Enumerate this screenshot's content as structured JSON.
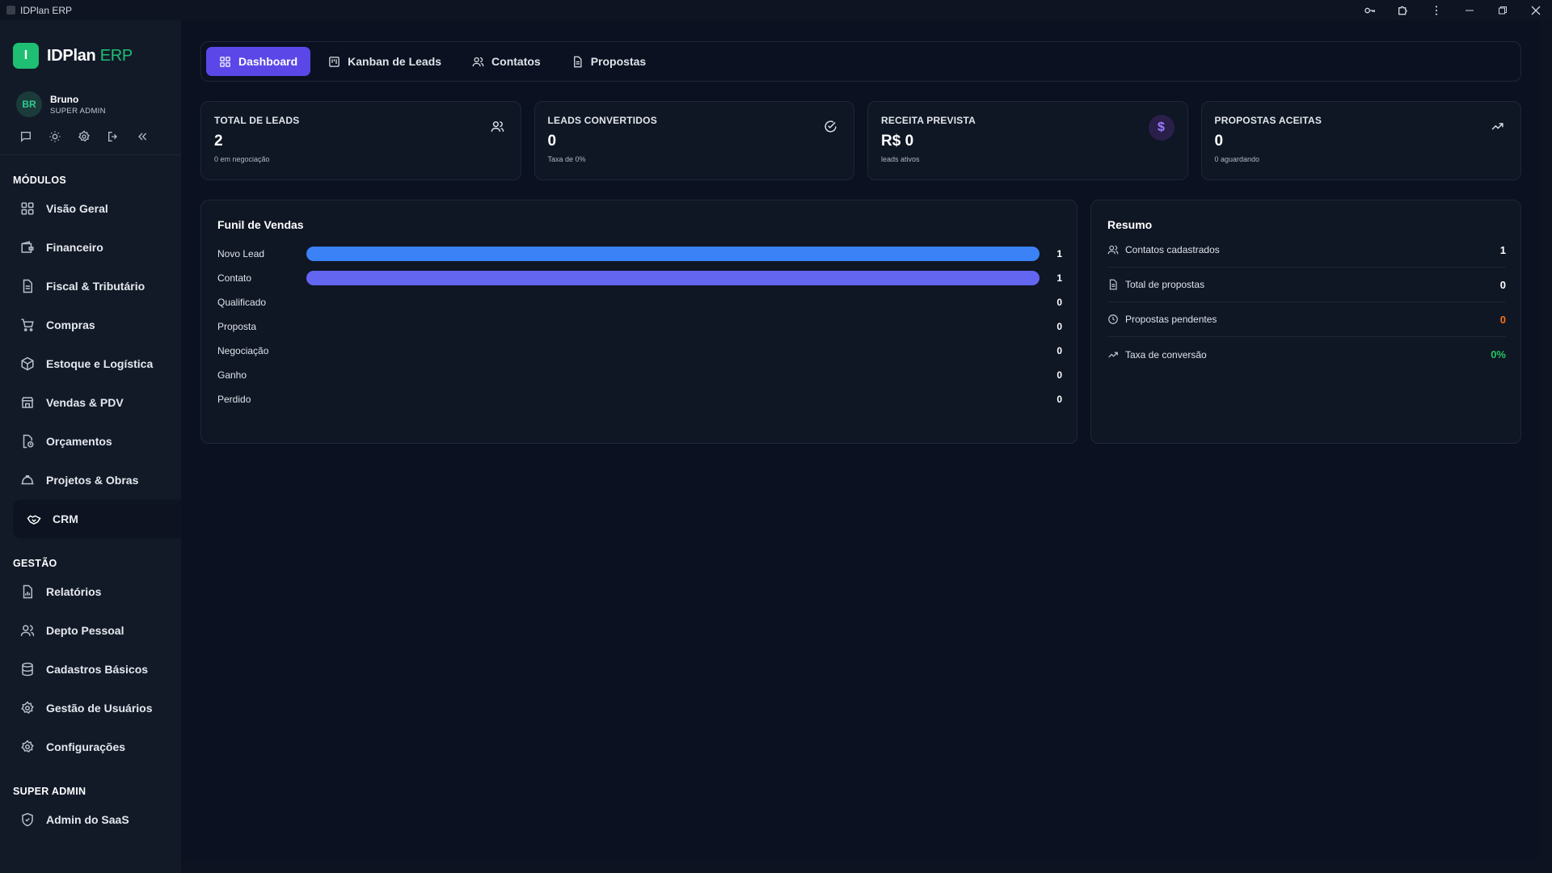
{
  "window": {
    "title": "IDPlan ERP"
  },
  "brand": {
    "logo_letter": "I",
    "name": "IDPlan",
    "suffix": "ERP",
    "accent": "#1fbf73"
  },
  "user": {
    "initials": "BR",
    "name": "Bruno",
    "role": "SUPER ADMIN"
  },
  "user_actions": [
    "chat-icon",
    "sun-icon",
    "gear-icon",
    "logout-icon",
    "collapse-icon"
  ],
  "sidebar": {
    "sections": [
      {
        "title": "MÓDULOS",
        "items": [
          {
            "label": "Visão Geral",
            "icon": "grid-icon"
          },
          {
            "label": "Financeiro",
            "icon": "wallet-icon"
          },
          {
            "label": "Fiscal & Tributário",
            "icon": "document-icon"
          },
          {
            "label": "Compras",
            "icon": "cart-icon"
          },
          {
            "label": "Estoque e Logística",
            "icon": "box-icon"
          },
          {
            "label": "Vendas & PDV",
            "icon": "store-icon"
          },
          {
            "label": "Orçamentos",
            "icon": "file-clock-icon"
          },
          {
            "label": "Projetos & Obras",
            "icon": "hardhat-icon"
          },
          {
            "label": "CRM",
            "icon": "handshake-icon",
            "active": true
          }
        ]
      },
      {
        "title": "GESTÃO",
        "items": [
          {
            "label": "Relatórios",
            "icon": "chart-file-icon"
          },
          {
            "label": "Depto Pessoal",
            "icon": "users-icon"
          },
          {
            "label": "Cadastros Básicos",
            "icon": "database-icon"
          },
          {
            "label": "Gestão de Usuários",
            "icon": "user-gear-icon"
          },
          {
            "label": "Configurações",
            "icon": "gear-icon"
          }
        ]
      },
      {
        "title": "SUPER ADMIN",
        "items": [
          {
            "label": "Admin do SaaS",
            "icon": "shield-icon"
          }
        ]
      }
    ]
  },
  "tabs": [
    {
      "label": "Dashboard",
      "icon": "grid-icon",
      "active": true
    },
    {
      "label": "Kanban de Leads",
      "icon": "kanban-icon"
    },
    {
      "label": "Contatos",
      "icon": "users-icon"
    },
    {
      "label": "Propostas",
      "icon": "document-icon"
    }
  ],
  "cards": [
    {
      "title": "TOTAL DE LEADS",
      "value": "2",
      "sub": "0 em negociação",
      "icon": "users-icon"
    },
    {
      "title": "LEADS CONVERTIDOS",
      "value": "0",
      "sub": "Taxa de 0%",
      "icon": "check-circle-icon"
    },
    {
      "title": "RECEITA PREVISTA",
      "value": "R$ 0",
      "sub": "leads ativos",
      "icon": "dollar-icon",
      "icon_glyph": "$"
    },
    {
      "title": "PROPOSTAS ACEITAS",
      "value": "0",
      "sub": "0 aguardando",
      "icon": "trending-up-icon"
    }
  ],
  "funnel": {
    "title": "Funil de Vendas",
    "max": 1,
    "stages": [
      {
        "label": "Novo Lead",
        "value": 1,
        "color": "#3b82f6"
      },
      {
        "label": "Contato",
        "value": 1,
        "color": "#6366f1"
      },
      {
        "label": "Qualificado",
        "value": 0,
        "color": "#8b5cf6"
      },
      {
        "label": "Proposta",
        "value": 0,
        "color": "#a855f7"
      },
      {
        "label": "Negociação",
        "value": 0,
        "color": "#f59e0b"
      },
      {
        "label": "Ganho",
        "value": 0,
        "color": "#22c55e"
      },
      {
        "label": "Perdido",
        "value": 0,
        "color": "#ef4444"
      }
    ]
  },
  "resumo": {
    "title": "Resumo",
    "rows": [
      {
        "label": "Contatos cadastrados",
        "value": "1",
        "icon": "users-icon",
        "color": "#ffffff"
      },
      {
        "label": "Total de propostas",
        "value": "0",
        "icon": "document-icon",
        "color": "#ffffff"
      },
      {
        "label": "Propostas pendentes",
        "value": "0",
        "icon": "clock-icon",
        "color": "#f97316"
      },
      {
        "label": "Taxa de conversão",
        "value": "0%",
        "icon": "trending-up-icon",
        "color": "#22c55e"
      }
    ]
  }
}
